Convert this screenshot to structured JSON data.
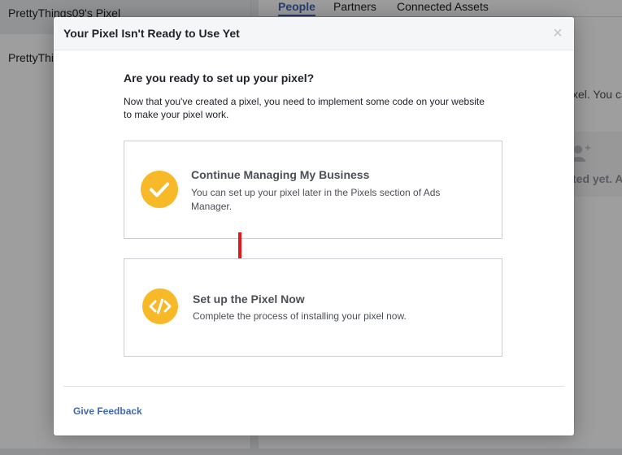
{
  "background": {
    "sidebar": {
      "selected_item": "PrettyThings09's Pixel",
      "second_item": "PrettyThi"
    },
    "tabs": [
      "People",
      "Partners",
      "Connected Assets"
    ],
    "fragments": {
      "text_pixel": "xel. You ca",
      "text_connected": "ted yet. A"
    }
  },
  "modal": {
    "title": "Your Pixel Isn't Ready to Use Yet",
    "close_symbol": "×",
    "question": "Are you ready to set up your pixel?",
    "intro": "Now that you've created a pixel, you need to implement some code on your website to make your pixel work.",
    "options": [
      {
        "title": "Continue Managing My Business",
        "description": "You can set up your pixel later in the Pixels section of Ads Manager.",
        "icon": "checkmark-icon"
      },
      {
        "title": "Set up the Pixel Now",
        "description": "Complete the process of installing your pixel now.",
        "icon": "code-icon"
      }
    ],
    "feedback_label": "Give Feedback"
  },
  "colors": {
    "accent": "#4267b2",
    "icon_yellow": "#f7b928",
    "annotation_arrow": "#e0191b"
  }
}
